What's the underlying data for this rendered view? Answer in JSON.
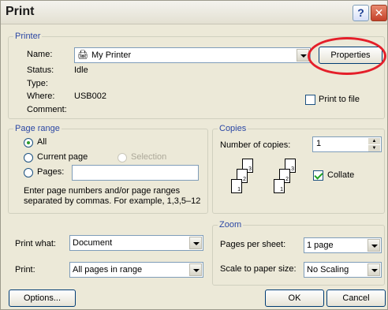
{
  "window": {
    "title": "Print"
  },
  "printer": {
    "legend": "Printer",
    "name_label": "Name:",
    "name_value": "My Printer",
    "properties_label": "Properties",
    "status_label": "Status:",
    "status_value": "Idle",
    "type_label": "Type:",
    "type_value": "",
    "where_label": "Where:",
    "where_value": "USB002",
    "comment_label": "Comment:",
    "comment_value": "",
    "print_to_file_label": "Print to file"
  },
  "page_range": {
    "legend": "Page range",
    "all_label": "All",
    "current_page_label": "Current page",
    "selection_label": "Selection",
    "pages_label": "Pages:",
    "pages_value": "",
    "hint_line1": "Enter page numbers and/or page ranges",
    "hint_line2": "separated by commas.  For example, 1,3,5–12"
  },
  "copies": {
    "legend": "Copies",
    "number_label": "Number of copies:",
    "number_value": "1",
    "collate_label": "Collate",
    "collate_pages": [
      "1",
      "2",
      "3",
      "1",
      "2",
      "3"
    ]
  },
  "zoom": {
    "legend": "Zoom",
    "pages_per_sheet_label": "Pages per sheet:",
    "pages_per_sheet_value": "1 page",
    "scale_label": "Scale to paper size:",
    "scale_value": "No Scaling"
  },
  "print_what": {
    "label": "Print what:",
    "value": "Document"
  },
  "print_range": {
    "label": "Print:",
    "value": "All pages in range"
  },
  "buttons": {
    "options": "Options...",
    "ok": "OK",
    "cancel": "Cancel"
  },
  "highlight_color": "#e41f2a"
}
